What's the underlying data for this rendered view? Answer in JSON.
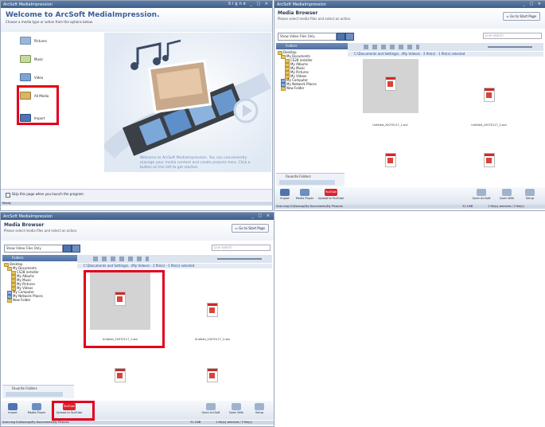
{
  "colors": {
    "highlight": "#e2001a",
    "title_bar": "#4a6c99",
    "youtube": "#d9232e",
    "panel_head": "#5b7cad"
  },
  "welcome": {
    "app_title": "ArcSoft MediaImpression",
    "window_controls": "Signe _ □ ×",
    "heading": "Welcome to ArcSoft MediaImpression.",
    "subheading": "Choose a media type or action from the options below.",
    "items": [
      {
        "label": "Pictures",
        "icon": "pictures-icon"
      },
      {
        "label": "Music",
        "icon": "music-icon"
      },
      {
        "label": "Video",
        "icon": "video-icon"
      },
      {
        "label": "All Media",
        "icon": "all-media-icon"
      },
      {
        "label": "Import",
        "icon": "import-icon"
      }
    ],
    "description": "Welcome to ArcSoft MediaImpression. You can conveniently manage your media content and create projects here. Click a button on the left to get started.",
    "skip_label": "Skip this page when you launch the program",
    "status": "Ready"
  },
  "browser_a": {
    "app_title": "ArcSoft MediaImpression",
    "window_controls": "_ □ ×",
    "heading": "Media Browser",
    "subheading": "Please select media files and select an action.",
    "goto_label": "Go to Start Page",
    "filter_value": "Show Video Files Only",
    "search_placeholder": "Live search",
    "folders_label": "Folders",
    "tree": [
      "Desktop",
      "My Documents",
      "CS28 installer",
      "My Albums",
      "My Music",
      "My Pictures",
      "My Videos",
      "My Computer",
      "My Network Places",
      "New Folder"
    ],
    "info_bar": "C:\\Documents and Settings\\...\\My Videos\\ - 2 file(s) - 1 file(s) selected",
    "thumbs": [
      "Untitled_20070117_1.wvi",
      "Untitled_20070117_2.wvi",
      "",
      ""
    ],
    "favorite_label": "Favorite Folders",
    "actions": [
      "Import",
      "Media Player",
      "Upload to YouTube"
    ],
    "right_actions": [
      "Open ArcSoft",
      "Open With",
      "Setup"
    ],
    "youtube_logo": "YouTube",
    "status_left": "Scanning D:\\Backup\\My Documents\\My Pictures",
    "status_mid": "31.1MB",
    "status_right": "1 file(s) selected / 3 file(s)"
  },
  "browser_b": {
    "app_title": "ArcSoft MediaImpression",
    "window_controls": "_ □ ×",
    "heading": "Media Browser",
    "subheading": "Please select media files and select an action.",
    "goto_label": "Go to Start Page",
    "filter_value": "Show Video Files Only",
    "search_placeholder": "Live search",
    "folders_label": "Folders",
    "tree": [
      "Desktop",
      "My Documents",
      "CS28 installer",
      "My Albums",
      "My Music",
      "My Pictures",
      "My Videos",
      "My Computer",
      "My Network Places",
      "New Folder"
    ],
    "info_bar": "C:\\Documents and Settings\\...\\My Videos\\ - 2 file(s) - 1 file(s) selected",
    "thumbs": [
      "Untitled_20070117_1.wvi",
      "Untitled_20070117_2.wvi",
      "",
      ""
    ],
    "favorite_label": "Favorite Folders",
    "actions": [
      "Import",
      "Media Player",
      "Upload to YouTube"
    ],
    "right_actions": [
      "Open ArcSoft",
      "Open With",
      "Setup"
    ],
    "youtube_logo": "YouTube",
    "status_left": "Scanning D:\\Backup\\My Documents\\My Pictures",
    "status_mid": "31.1MB",
    "status_right": "1 file(s) selected / 3 file(s)"
  }
}
